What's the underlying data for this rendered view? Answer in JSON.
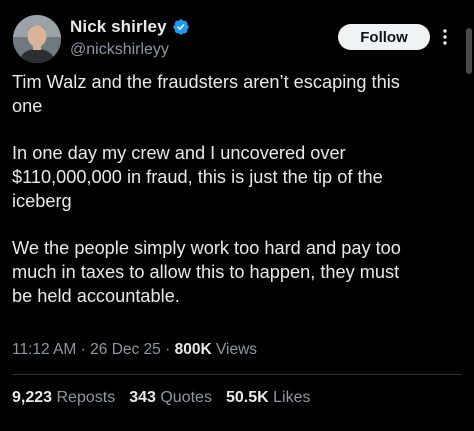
{
  "author": {
    "display_name": "Nick shirley",
    "handle": "@nickshirleyy",
    "verified": true,
    "avatar_icon": "user-avatar-photo"
  },
  "actions": {
    "follow_label": "Follow",
    "more_icon": "vertical-ellipsis-icon"
  },
  "tweet": {
    "paragraphs": [
      "Tim Walz and the fraudsters aren’t escaping this\none",
      "In one day my crew and I uncovered over\n$110,000,000 in fraud, this is just the tip of the\niceberg",
      "We the people simply work too hard and pay too\nmuch in taxes to allow this to happen, they must\nbe held accountable."
    ]
  },
  "meta": {
    "time": "11:12 AM",
    "date": "26 Dec 25",
    "separator": "·",
    "views_count": "800K",
    "views_label": "Views"
  },
  "stats": {
    "reposts_count": "9,223",
    "reposts_label": "Reposts",
    "quotes_count": "343",
    "quotes_label": "Quotes",
    "likes_count": "50.5K",
    "likes_label": "Likes"
  },
  "colors": {
    "background": "#000000",
    "text_primary": "#e7e9ea",
    "text_secondary": "#8b98a5",
    "verified_blue": "#1d9bf0",
    "follow_bg": "#eff3f4",
    "divider": "#2f3336"
  }
}
